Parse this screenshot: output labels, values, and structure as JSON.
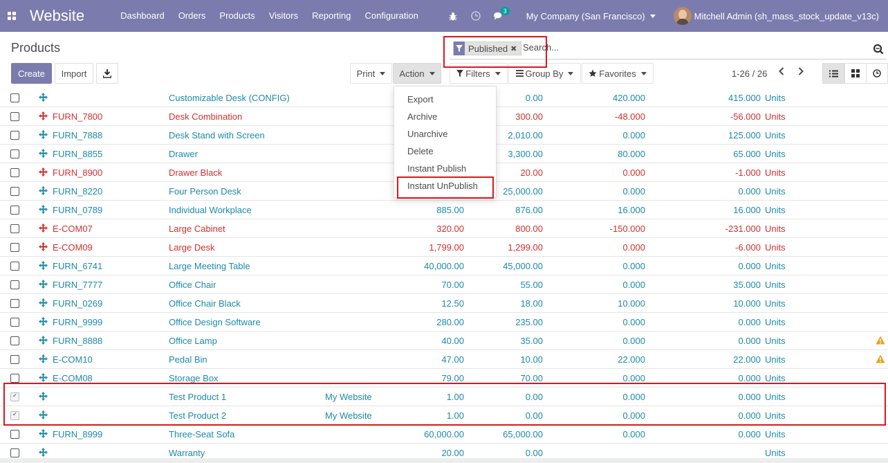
{
  "navbar": {
    "app_title": "Website",
    "menu": [
      "Dashboard",
      "Orders",
      "Products",
      "Visitors",
      "Reporting",
      "Configuration"
    ],
    "messages_badge": "3",
    "company": "My Company (San Francisco)",
    "user": "Mitchell Admin (sh_mass_stock_update_v13c)"
  },
  "control_panel": {
    "breadcrumb": "Products",
    "create_label": "Create",
    "import_label": "Import",
    "print_label": "Print",
    "action_label": "Action",
    "filters_label": "Filters",
    "group_by_label": "Group By",
    "favorites_label": "Favorites",
    "pager": "1-26 / 26",
    "search": {
      "facet": "Published",
      "placeholder": "Search..."
    }
  },
  "action_menu": [
    "Export",
    "Archive",
    "Unarchive",
    "Delete",
    "Instant Publish",
    "Instant UnPublish"
  ],
  "colors": {
    "brand": "#7c7bad",
    "teal": "#1c8aa7",
    "red": "#d12f2f",
    "warning": "#e8a317",
    "highlight": "#e0141e"
  },
  "rows": [
    {
      "ref": "",
      "name": "Customizable Desk (CONFIG)",
      "website": "",
      "price": "",
      "cost": "0.00",
      "onhand": "420.000",
      "forecast": "415.000",
      "uom": "Units",
      "color": "teal",
      "checked": false,
      "warn": false
    },
    {
      "ref": "FURN_7800",
      "name": "Desk Combination",
      "website": "",
      "price": "",
      "cost": "300.00",
      "onhand": "-48.000",
      "forecast": "-56.000",
      "uom": "Units",
      "color": "red",
      "checked": false,
      "warn": false
    },
    {
      "ref": "FURN_7888",
      "name": "Desk Stand with Screen",
      "website": "",
      "price": "",
      "cost": "2,010.00",
      "onhand": "0.000",
      "forecast": "125.000",
      "uom": "Units",
      "color": "teal",
      "checked": false,
      "warn": false
    },
    {
      "ref": "FURN_8855",
      "name": "Drawer",
      "website": "",
      "price": "",
      "cost": "3,300.00",
      "onhand": "80.000",
      "forecast": "65.000",
      "uom": "Units",
      "color": "teal",
      "checked": false,
      "warn": false
    },
    {
      "ref": "FURN_8900",
      "name": "Drawer Black",
      "website": "",
      "price": "",
      "cost": "20.00",
      "onhand": "0.000",
      "forecast": "-1.000",
      "uom": "Units",
      "color": "red",
      "checked": false,
      "warn": false
    },
    {
      "ref": "FURN_8220",
      "name": "Four Person Desk",
      "website": "",
      "price": "",
      "cost": "25,000.00",
      "onhand": "0.000",
      "forecast": "0.000",
      "uom": "Units",
      "color": "teal",
      "checked": false,
      "warn": false
    },
    {
      "ref": "FURN_0789",
      "name": "Individual Workplace",
      "website": "",
      "price": "885.00",
      "cost": "876.00",
      "onhand": "16.000",
      "forecast": "16.000",
      "uom": "Units",
      "color": "teal",
      "checked": false,
      "warn": false
    },
    {
      "ref": "E-COM07",
      "name": "Large Cabinet",
      "website": "",
      "price": "320.00",
      "cost": "800.00",
      "onhand": "-150.000",
      "forecast": "-231.000",
      "uom": "Units",
      "color": "red",
      "checked": false,
      "warn": false
    },
    {
      "ref": "E-COM09",
      "name": "Large Desk",
      "website": "",
      "price": "1,799.00",
      "cost": "1,299.00",
      "onhand": "0.000",
      "forecast": "-6.000",
      "uom": "Units",
      "color": "red",
      "checked": false,
      "warn": false
    },
    {
      "ref": "FURN_6741",
      "name": "Large Meeting Table",
      "website": "",
      "price": "40,000.00",
      "cost": "45,000.00",
      "onhand": "0.000",
      "forecast": "0.000",
      "uom": "Units",
      "color": "teal",
      "checked": false,
      "warn": false
    },
    {
      "ref": "FURN_7777",
      "name": "Office Chair",
      "website": "",
      "price": "70.00",
      "cost": "55.00",
      "onhand": "0.000",
      "forecast": "35.000",
      "uom": "Units",
      "color": "teal",
      "checked": false,
      "warn": false
    },
    {
      "ref": "FURN_0269",
      "name": "Office Chair Black",
      "website": "",
      "price": "12.50",
      "cost": "18.00",
      "onhand": "10.000",
      "forecast": "10.000",
      "uom": "Units",
      "color": "teal",
      "checked": false,
      "warn": false
    },
    {
      "ref": "FURN_9999",
      "name": "Office Design Software",
      "website": "",
      "price": "280.00",
      "cost": "235.00",
      "onhand": "0.000",
      "forecast": "0.000",
      "uom": "Units",
      "color": "teal",
      "checked": false,
      "warn": false
    },
    {
      "ref": "FURN_8888",
      "name": "Office Lamp",
      "website": "",
      "price": "40.00",
      "cost": "35.00",
      "onhand": "0.000",
      "forecast": "0.000",
      "uom": "Units",
      "color": "teal",
      "checked": false,
      "warn": true
    },
    {
      "ref": "E-COM10",
      "name": "Pedal Bin",
      "website": "",
      "price": "47.00",
      "cost": "10.00",
      "onhand": "22.000",
      "forecast": "22.000",
      "uom": "Units",
      "color": "teal",
      "checked": false,
      "warn": true
    },
    {
      "ref": "E-COM08",
      "name": "Storage Box",
      "website": "",
      "price": "79.00",
      "cost": "70.00",
      "onhand": "0.000",
      "forecast": "0.000",
      "uom": "Units",
      "color": "teal",
      "checked": false,
      "warn": false
    },
    {
      "ref": "",
      "name": "Test Product 1",
      "website": "My Website",
      "price": "1.00",
      "cost": "0.00",
      "onhand": "0.000",
      "forecast": "0.000",
      "uom": "Units",
      "color": "teal",
      "checked": true,
      "warn": false
    },
    {
      "ref": "",
      "name": "Test Product 2",
      "website": "My Website",
      "price": "1.00",
      "cost": "0.00",
      "onhand": "0.000",
      "forecast": "0.000",
      "uom": "Units",
      "color": "teal",
      "checked": true,
      "warn": false
    },
    {
      "ref": "FURN_8999",
      "name": "Three-Seat Sofa",
      "website": "",
      "price": "60,000.00",
      "cost": "65,000.00",
      "onhand": "0.000",
      "forecast": "0.000",
      "uom": "Units",
      "color": "teal",
      "checked": false,
      "warn": false
    },
    {
      "ref": "",
      "name": "Warranty",
      "website": "",
      "price": "20.00",
      "cost": "0.00",
      "onhand": "",
      "forecast": "",
      "uom": "Units",
      "color": "teal",
      "checked": false,
      "warn": false
    }
  ]
}
